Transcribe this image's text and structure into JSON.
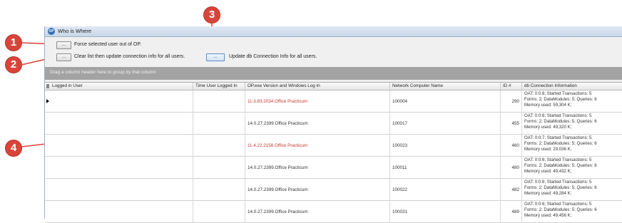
{
  "callouts": [
    "1",
    "2",
    "3",
    "4"
  ],
  "window": {
    "title": "Who is Where",
    "app_icon_text": "OP"
  },
  "toolbar": {
    "force_out_label": "Force selected user out of OP.",
    "clear_update_label": "Clear list then update connection info for all users.",
    "update_db_label": "Update db Connection Info for all users.",
    "button_glyph": "..."
  },
  "group_panel": {
    "hint": "Drag a column header here to group by that column"
  },
  "columns": [
    "Logged in User",
    "Time User Logged In",
    "OP.exe Version and Windows Log In",
    "Network Computer Name",
    "ID #",
    "db Connection Information"
  ],
  "rows": [
    {
      "user": "",
      "time": "",
      "version": "11.3.83.2034.Office Practicum",
      "computer": "100004",
      "id": "290",
      "conn": [
        "OAT: 0:0:8;   Started Transactions: 5",
        "Forms: 2;   DataModules: 5;   Queries: 6",
        "Memory used: 59,304 K;"
      ],
      "current": true,
      "version_red": true
    },
    {
      "user": "",
      "time": "",
      "version": "14.0.27.2399.Office Practicum",
      "computer": "100017",
      "id": "455",
      "conn": [
        "OAT: 0:0:6;   Started Transactions: 5",
        "Forms: 2;   DataModules: 5;   Queries: 6",
        "Memory used: 49,320 K;"
      ],
      "current": false,
      "version_red": false
    },
    {
      "user": "",
      "time": "",
      "version": "11.4.22.2158.Office Practicum",
      "computer": "100023",
      "id": "460",
      "conn": [
        "OAT: 0:0:7;   Started Transactions: 5",
        "Forms: 2;   DataModules: 5;   Queries: 6",
        "Memory used: 29,036 K;"
      ],
      "current": false,
      "version_red": true
    },
    {
      "user": "",
      "time": "",
      "version": "14.0.27.2399.Office Practicum",
      "computer": "100011",
      "id": "480",
      "conn": [
        "OAT: 0:0:6;   Started Transactions: 5",
        "Forms: 2;   DataModules: 5;   Queries: 6",
        "Memory used: 49,432 K;"
      ],
      "current": false,
      "version_red": false
    },
    {
      "user": "",
      "time": "",
      "version": "14.0.27.2399.Office Practicum",
      "computer": "100022",
      "id": "482",
      "conn": [
        "OAT: 0:0:6;   Started Transactions: 5",
        "Forms: 2;   DataModules: 5;   Queries: 6",
        "Memory used: 49,284 K;"
      ],
      "current": false,
      "version_red": false
    },
    {
      "user": "",
      "time": "",
      "version": "14.0.27.2399.Office Practicum",
      "computer": "100031",
      "id": "489",
      "conn": [
        "OAT: 0:0:6;   Started Transactions: 5",
        "Forms: 2;   DataModules: 5;   Queries: 6",
        "Memory used: 49,456 K;"
      ],
      "current": false,
      "version_red": false
    }
  ],
  "colors": {
    "callout": "#d9443a",
    "group_bar": "#a3a3a3",
    "version_highlight": "#c83a2e"
  }
}
